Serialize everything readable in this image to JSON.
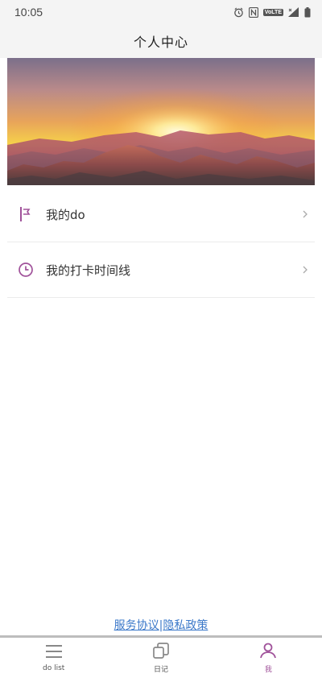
{
  "status_bar": {
    "time": "10:05",
    "volte": "VoLTE",
    "icons": [
      "alarm-icon",
      "nfc-icon",
      "volte-icon",
      "signal-icon",
      "battery-icon"
    ]
  },
  "header": {
    "title": "个人中心"
  },
  "banner": {
    "image": "mountain-sunset"
  },
  "menu": {
    "items": [
      {
        "label": "我的do",
        "icon": "flag-icon"
      },
      {
        "label": "我的打卡时间线",
        "icon": "clock-icon"
      }
    ]
  },
  "policy": {
    "service": "服务协议",
    "separator": "|",
    "privacy": "隐私政策"
  },
  "tabs": [
    {
      "label": "do list",
      "icon": "list-icon",
      "active": false
    },
    {
      "label": "日记",
      "icon": "diary-icon",
      "active": false
    },
    {
      "label": "我",
      "icon": "person-icon",
      "active": true
    }
  ],
  "colors": {
    "accent": "#a0529a",
    "link": "#3b78c9",
    "header_bg": "#f4f4f4"
  }
}
